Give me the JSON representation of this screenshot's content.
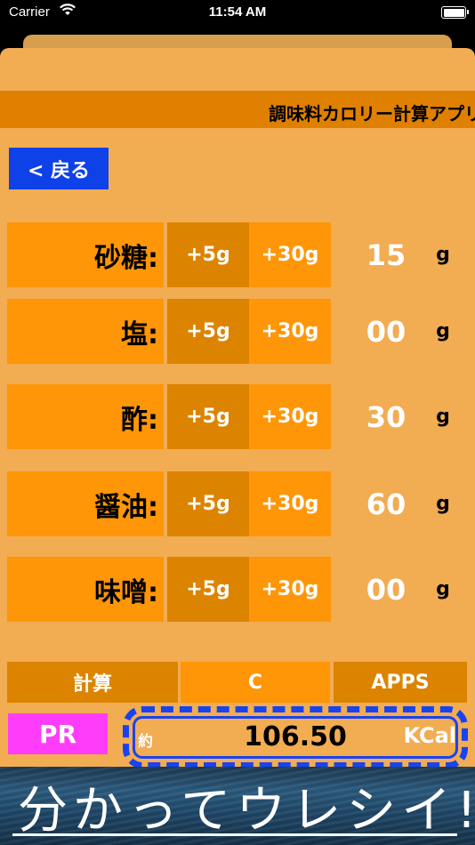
{
  "status": {
    "carrier": "Carrier",
    "time": "11:54 AM"
  },
  "header": {
    "title": "調味料カロリー計算アプリ"
  },
  "back_button": "< 戻る",
  "rows": [
    {
      "label": "砂糖:",
      "plus5": "+5g",
      "plus30": "+30g",
      "value": "15",
      "unit": "g"
    },
    {
      "label": "塩:",
      "plus5": "+5g",
      "plus30": "+30g",
      "value": "00",
      "unit": "g"
    },
    {
      "label": "酢:",
      "plus5": "+5g",
      "plus30": "+30g",
      "value": "30",
      "unit": "g"
    },
    {
      "label": "醤油:",
      "plus5": "+5g",
      "plus30": "+30g",
      "value": "60",
      "unit": "g"
    },
    {
      "label": "味噌:",
      "plus5": "+5g",
      "plus30": "+30g",
      "value": "00",
      "unit": "g"
    }
  ],
  "bottom_buttons": {
    "calc": "計算",
    "clear": "C",
    "apps": "APPS"
  },
  "pr_button": "PR",
  "result": {
    "approx": "約",
    "value": "106.50",
    "unit": "KCal"
  },
  "banner": {
    "text": "分かってウレシイ!"
  },
  "colors": {
    "accent_orange": "#ff9607",
    "header_orange": "#e08000",
    "back_blue": "#0e41e8",
    "pr_pink": "#ff3cfa"
  }
}
